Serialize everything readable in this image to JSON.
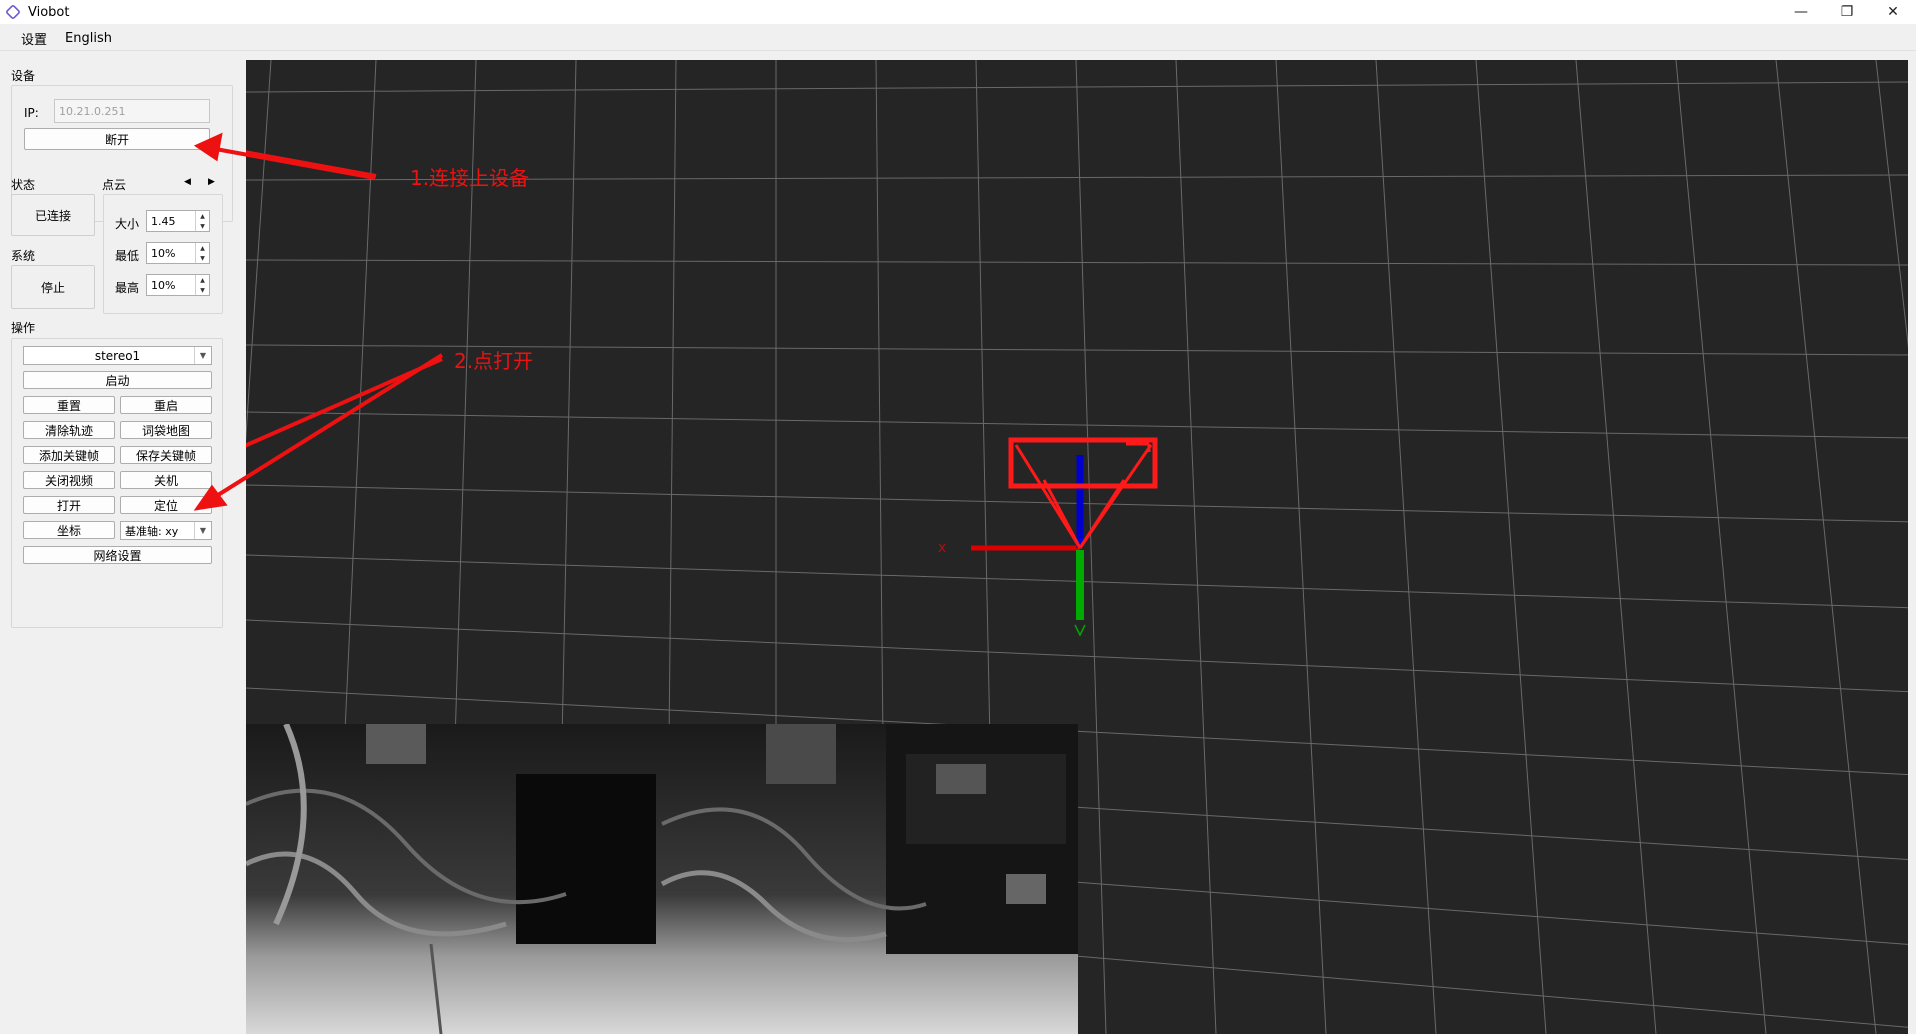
{
  "window": {
    "title": "Viobot",
    "minimize_icon": "minimize-icon",
    "restore_icon": "restore-icon",
    "close_icon": "close-icon"
  },
  "menu": {
    "settings": "设置",
    "language": "English"
  },
  "device": {
    "section": "设备",
    "ip_label": "IP:",
    "ip_value": "10.21.0.251",
    "disconnect_button": "断开"
  },
  "status": {
    "section": "状态",
    "value": "已连接"
  },
  "system": {
    "section": "系统",
    "stop_button": "停止"
  },
  "pointcloud": {
    "section": "点云",
    "size_label": "大小",
    "size_value": "1.45",
    "min_label": "最低",
    "min_value": "10%",
    "max_label": "最高",
    "max_value": "10%"
  },
  "operations": {
    "section": "操作",
    "mode_selected": "stereo1",
    "start": "启动",
    "reset": "重置",
    "restart": "重启",
    "clear_trajectory": "清除轨迹",
    "bow_map": "词袋地图",
    "add_keyframe": "添加关键帧",
    "save_keyframe": "保存关键帧",
    "close_video": "关闭视频",
    "shutdown": "关机",
    "open": "打开",
    "localize": "定位",
    "coordinate": "坐标",
    "base_axis": "基准轴: xy",
    "network_settings": "网络设置"
  },
  "annotations": {
    "step1": "1.连接上设备",
    "step2": "2.点打开",
    "color": "#ff0000"
  },
  "viewport": {
    "background": "#252525",
    "grid_color": "#8a8a8a",
    "axis_x_label": "x"
  },
  "colors": {
    "axis_x": "#dd0000",
    "axis_y": "#00aa00",
    "axis_z": "#0000cc"
  }
}
